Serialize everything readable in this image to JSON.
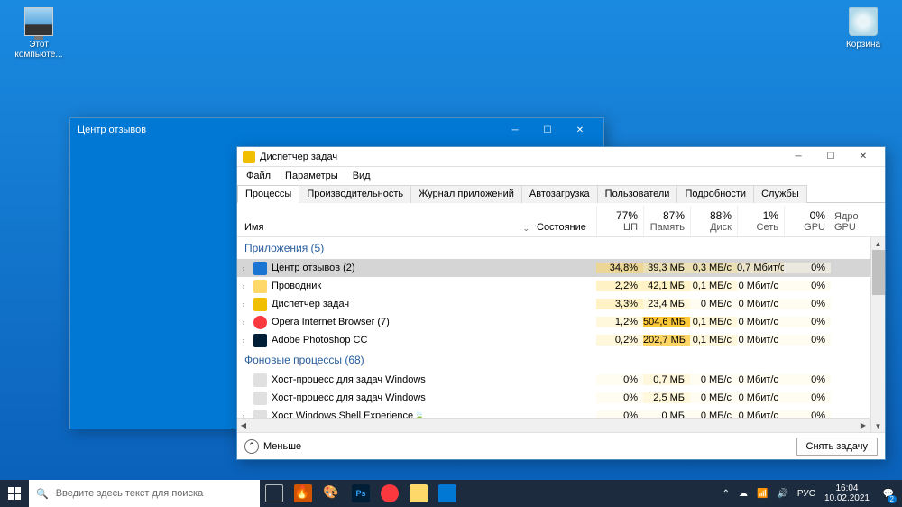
{
  "desktop": {
    "thispc": "Этот компьюте...",
    "recycle": "Корзина"
  },
  "feedback_window": {
    "title": "Центр отзывов"
  },
  "taskmgr": {
    "title": "Диспетчер задач",
    "menu": [
      "Файл",
      "Параметры",
      "Вид"
    ],
    "tabs": [
      "Процессы",
      "Производительность",
      "Журнал приложений",
      "Автозагрузка",
      "Пользователи",
      "Подробности",
      "Службы"
    ],
    "active_tab": 0,
    "header": {
      "name": "Имя",
      "status": "Состояние",
      "cols": [
        {
          "pct": "77%",
          "label": "ЦП"
        },
        {
          "pct": "87%",
          "label": "Память"
        },
        {
          "pct": "88%",
          "label": "Диск"
        },
        {
          "pct": "1%",
          "label": "Сеть"
        },
        {
          "pct": "0%",
          "label": "GPU"
        }
      ],
      "gpu_engine": "Ядро GPU"
    },
    "groups": [
      {
        "label": "Приложения (5)",
        "rows": [
          {
            "exp": true,
            "icon": "#1975d1",
            "name": "Центр отзывов (2)",
            "sel": true,
            "cpu": "34,8%",
            "mem": "39,3 МБ",
            "disk": "0,3 МБ/с",
            "net": "0,7 Мбит/с",
            "gpu": "0%",
            "h": [
              3,
              2,
              2,
              1,
              0
            ]
          },
          {
            "exp": true,
            "icon": "#ffd86a",
            "name": "Проводник",
            "cpu": "2,2%",
            "mem": "42,1 МБ",
            "disk": "0,1 МБ/с",
            "net": "0 Мбит/с",
            "gpu": "0%",
            "h": [
              2,
              2,
              1,
              0,
              0
            ]
          },
          {
            "exp": true,
            "icon": "#f0c000",
            "name": "Диспетчер задач",
            "cpu": "3,3%",
            "mem": "23,4 МБ",
            "disk": "0 МБ/с",
            "net": "0 Мбит/с",
            "gpu": "0%",
            "h": [
              2,
              1,
              0,
              0,
              0
            ]
          },
          {
            "exp": true,
            "icon": "#fa383e",
            "name": "Opera Internet Browser (7)",
            "cpu": "1,2%",
            "mem": "504,6 МБ",
            "disk": "0,1 МБ/с",
            "net": "0 Мбит/с",
            "gpu": "0%",
            "h": [
              1,
              5,
              1,
              0,
              0
            ],
            "iconround": true
          },
          {
            "exp": true,
            "icon": "#001e36",
            "name": "Adobe Photoshop CC",
            "cpu": "0,2%",
            "mem": "202,7 МБ",
            "disk": "0,1 МБ/с",
            "net": "0 Мбит/с",
            "gpu": "0%",
            "h": [
              1,
              4,
              1,
              0,
              0
            ]
          }
        ]
      },
      {
        "label": "Фоновые процессы (68)",
        "rows": [
          {
            "icon": "#e0e0e0",
            "name": "Хост-процесс для задач Windows",
            "cpu": "0%",
            "mem": "0,7 МБ",
            "disk": "0 МБ/с",
            "net": "0 Мбит/с",
            "gpu": "0%",
            "h": [
              0,
              1,
              0,
              0,
              0
            ]
          },
          {
            "icon": "#e0e0e0",
            "name": "Хост-процесс для задач Windows",
            "cpu": "0%",
            "mem": "2,5 МБ",
            "disk": "0 МБ/с",
            "net": "0 Мбит/с",
            "gpu": "0%",
            "h": [
              0,
              1,
              0,
              0,
              0
            ]
          },
          {
            "exp": true,
            "icon": "#e0e0e0",
            "name": "Хост Windows Shell Experience",
            "leaf": true,
            "cpu": "0%",
            "mem": "0 МБ",
            "disk": "0 МБ/с",
            "net": "0 Мбит/с",
            "gpu": "0%",
            "h": [
              0,
              0,
              0,
              0,
              0
            ]
          }
        ]
      }
    ],
    "fewer": "Меньше",
    "end_task": "Снять задачу"
  },
  "taskbar": {
    "search_placeholder": "Введите здесь текст для поиска",
    "lang": "РУС",
    "time": "16:04",
    "date": "10.02.2021",
    "notif_count": "2"
  }
}
